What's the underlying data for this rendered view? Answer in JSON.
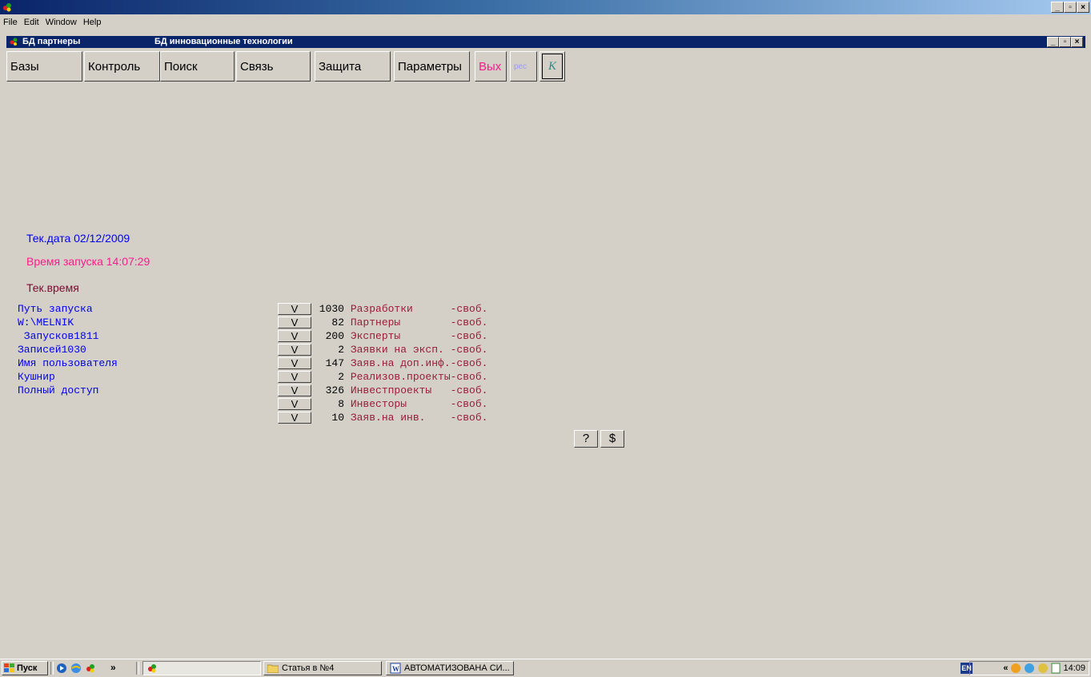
{
  "menubar": {
    "items": [
      "File",
      "Edit",
      "Window",
      "Help"
    ]
  },
  "document": {
    "title": "БД партнеры",
    "subtitle": "БД инновационные технологии"
  },
  "toolbar": {
    "bases": "Базы",
    "control": "Контроль",
    "search": "Поиск",
    "link": "Связь",
    "protect": "Защита",
    "params": "Параметры",
    "exit": "Вых",
    "res": "рес",
    "k": "K"
  },
  "info": {
    "date": "Тек.дата 02/12/2009",
    "start_time": "Время запуска 14:07:29",
    "cur_time": "Тек.время"
  },
  "left_info": [
    "Путь запуска",
    "W:\\MELNIK",
    " Запусков1811",
    "Записей1030",
    "Имя пользователя",
    "Кушнир",
    "Полный доступ"
  ],
  "db_rows": [
    {
      "btn": "V",
      "count": "1030",
      "name": "Разработки      -своб."
    },
    {
      "btn": "V",
      "count": "82",
      "name": "Партнеры        -своб."
    },
    {
      "btn": "V",
      "count": "200",
      "name": "Эксперты        -своб."
    },
    {
      "btn": "V",
      "count": "2",
      "name": "Заявки на эксп. -своб."
    },
    {
      "btn": "V",
      "count": "147",
      "name": "Заяв.на доп.инф.-своб."
    },
    {
      "btn": "V",
      "count": "2",
      "name": "Реализов.проекты-своб."
    },
    {
      "btn": "V",
      "count": "326",
      "name": "Инвестпроекты   -своб."
    },
    {
      "btn": "V",
      "count": "8",
      "name": "Инвесторы       -своб."
    },
    {
      "btn": "V",
      "count": "10",
      "name": "Заяв.на инв.    -своб."
    }
  ],
  "small_buttons": {
    "help": "?",
    "dollar": "$"
  },
  "taskbar": {
    "start": "Пуск",
    "chevron": "»",
    "tasks": [
      "Статья в №4",
      "АВТОМАТИЗОВАНА СИ..."
    ],
    "lang": "EN",
    "tray_chevron": "«",
    "time": "14:09"
  },
  "colors": {
    "blue_text": "#0000ee",
    "pink_text": "#ff1a8c",
    "maroon_text": "#7a0a2e",
    "db_name": "#9b1c38",
    "title_bar": "#0a246a"
  }
}
